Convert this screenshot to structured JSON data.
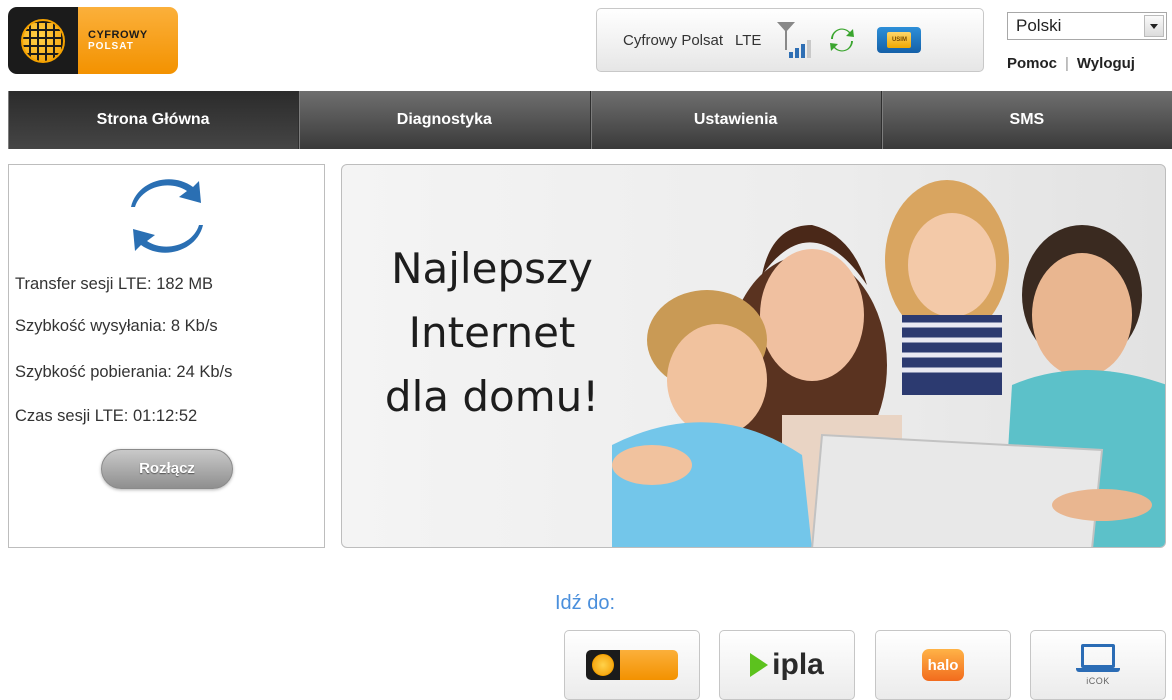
{
  "header": {
    "logo": {
      "line1": "CYFROWY",
      "line2": "POLSAT"
    },
    "status": {
      "operator": "Cyfrowy Polsat",
      "network_type": "LTE",
      "signal_bars": 3,
      "signal_bars_max": 4,
      "icons": [
        "signal-icon",
        "refresh-icon",
        "usim-card-icon"
      ],
      "sim_label": "USIM"
    },
    "language": {
      "selected": "Polski"
    },
    "links": {
      "help": "Pomoc",
      "logout": "Wyloguj"
    }
  },
  "nav": {
    "tabs": [
      {
        "label": "Strona Główna",
        "active": true
      },
      {
        "label": "Diagnostyka",
        "active": false
      },
      {
        "label": "Ustawienia",
        "active": false
      },
      {
        "label": "SMS",
        "active": false
      }
    ]
  },
  "connection": {
    "icon": "sync-icon",
    "transfer": "Transfer sesji LTE: 182 MB",
    "upload_speed": "Szybkość wysyłania: 8 Kb/s",
    "download_speed": "Szybkość pobierania: 24 Kb/s",
    "session_time": "Czas sesji LTE: 01:12:52",
    "disconnect_label": "Rozłącz"
  },
  "banner": {
    "line1": "Najlepszy",
    "line2": "Internet",
    "line3": "dla domu!"
  },
  "goto": {
    "label": "Idź do:",
    "links": [
      {
        "name": "cyfrowy-polsat-link",
        "icon": "cyfrowy-polsat-logo"
      },
      {
        "name": "ipla-link",
        "text": "ipla"
      },
      {
        "name": "halo-link",
        "text": "halo"
      },
      {
        "name": "icok-link",
        "text": "iCOK"
      }
    ]
  },
  "colors": {
    "accent_orange": "#f39200",
    "nav_dark": "#3a3a3a",
    "link_blue": "#4a8fdc",
    "refresh_green": "#3aa52e",
    "sync_blue": "#2a6fb3"
  }
}
